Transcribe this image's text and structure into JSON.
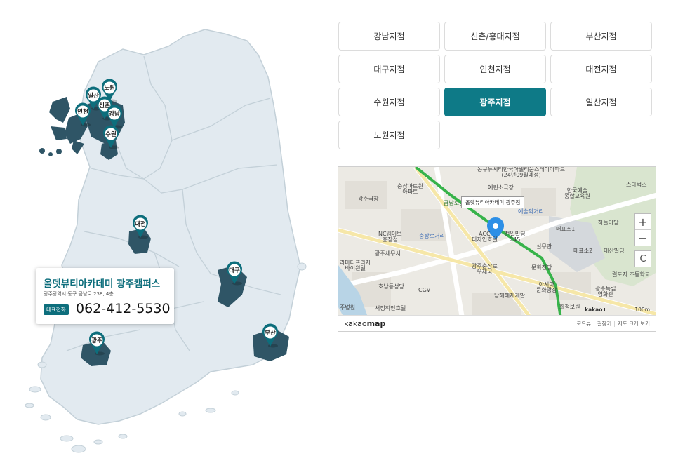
{
  "map_pins": [
    {
      "id": "ilsan",
      "label": "일산"
    },
    {
      "id": "nowon",
      "label": "노원"
    },
    {
      "id": "incheon",
      "label": "인천"
    },
    {
      "id": "sinchon",
      "label": "신촌"
    },
    {
      "id": "gangnam",
      "label": "강남"
    },
    {
      "id": "suwon",
      "label": "수원"
    },
    {
      "id": "daejeon",
      "label": "대전"
    },
    {
      "id": "daegu",
      "label": "대구"
    },
    {
      "id": "gwangju",
      "label": "광주"
    },
    {
      "id": "busan",
      "label": "부산"
    }
  ],
  "info_card": {
    "title": "올뎃뷰티아카데미 광주캠퍼스",
    "address": "광주광역시 동구 금남로 238, 4층",
    "phone_badge": "대표전화",
    "phone": "062-412-5530"
  },
  "branches": [
    {
      "label": "강남지점",
      "active": false
    },
    {
      "label": "신촌/홍대지점",
      "active": false
    },
    {
      "label": "부산지점",
      "active": false
    },
    {
      "label": "대구지점",
      "active": false
    },
    {
      "label": "인천지점",
      "active": false
    },
    {
      "label": "대전지점",
      "active": false
    },
    {
      "label": "수원지점",
      "active": false
    },
    {
      "label": "광주지점",
      "active": true
    },
    {
      "label": "일산지점",
      "active": false
    },
    {
      "label": "노원지점",
      "active": false
    }
  ],
  "map": {
    "marker_label": "올댓뷰티아카데미 광주점",
    "labels": {
      "l1": "동구뉴시티한국아델리움스테이아파트\n(24년09월예정)",
      "l2": "충장아트원\n아파트",
      "l3": "예린소극장",
      "l4": "한국예술\n종합교육원",
      "l5": "스타벅스",
      "l6": "광주극장",
      "l7": "금남로공원",
      "l8": "예술의거리",
      "l9": "하늘마당",
      "l10": "NC웨이브\n충장점",
      "l11": "충장로거리",
      "l12": "ACC\n디자인호텔",
      "l13": "전일빌딩\n245",
      "l14": "매표소1",
      "l15": "광주세무서",
      "l16": "실무관",
      "l17": "매표소2",
      "l18": "대산빌딩",
      "l19": "라마다프라자\n바이원텔",
      "l20": "광주충장로\n우체국",
      "l21": "문화전당",
      "l22": "호남동성당",
      "l23": "CGV",
      "l24": "아시아\n문화광장",
      "l25": "광주독립\n영화관",
      "l26": "남해해제개발",
      "l27": "서정적인호텔",
      "l28": "주병원",
      "l29": "회정보원",
      "l30": "광주극장",
      "l31": "렬도지 조등학교"
    },
    "zoom_in": "+",
    "zoom_out": "−",
    "reset": "C",
    "logo_a": "kakao",
    "logo_b": "map",
    "footer": {
      "roadview": "로드뷰",
      "directions": "길찾기",
      "larger": "지도 크게 보기"
    },
    "scale_label": "100m",
    "scale_brand": "kakao"
  },
  "colors": {
    "accent": "#0e7a87",
    "region_highlight": "#2f5566",
    "land": "#e2eaf0",
    "land_stroke": "#c3d0d8"
  }
}
